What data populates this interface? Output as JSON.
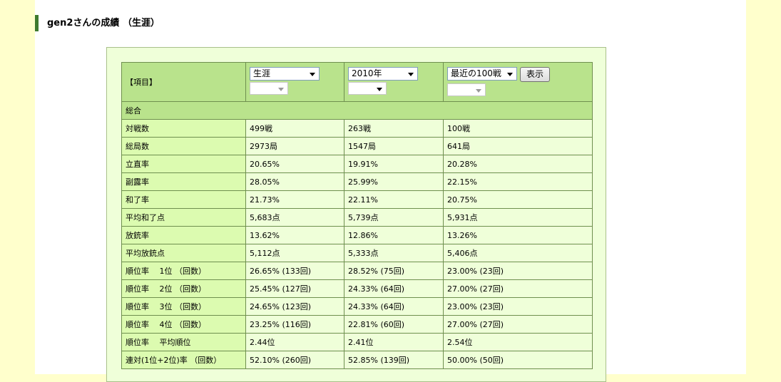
{
  "page": {
    "title": "gen2さんの成績 （生涯）"
  },
  "table": {
    "header_label": "【項目】",
    "selects": [
      {
        "value": "生涯",
        "sub_value": ""
      },
      {
        "value": "2010年",
        "sub_value": ""
      },
      {
        "value": "最近の100戦",
        "sub_value": ""
      }
    ],
    "show_button": "表示",
    "section_general": "総合",
    "rows": [
      {
        "label": "対戦数",
        "values": [
          "499戦",
          "263戦",
          "100戦"
        ]
      },
      {
        "label": "総局数",
        "values": [
          "2973局",
          "1547局",
          "641局"
        ]
      },
      {
        "label": "立直率",
        "values": [
          "20.65%",
          "19.91%",
          "20.28%"
        ]
      },
      {
        "label": "副露率",
        "values": [
          "28.05%",
          "25.99%",
          "22.15%"
        ]
      },
      {
        "label": "和了率",
        "values": [
          "21.73%",
          "22.11%",
          "20.75%"
        ]
      },
      {
        "label": "平均和了点",
        "values": [
          "5,683点",
          "5,739点",
          "5,931点"
        ]
      },
      {
        "label": "放銃率",
        "values": [
          "13.62%",
          "12.86%",
          "13.26%"
        ]
      },
      {
        "label": "平均放銃点",
        "values": [
          "5,112点",
          "5,333点",
          "5,406点"
        ]
      },
      {
        "label": "順位率　 1位 （回数）",
        "values": [
          "26.65% (133回)",
          "28.52% (75回)",
          "23.00% (23回)"
        ]
      },
      {
        "label": "順位率　 2位 （回数）",
        "values": [
          "25.45% (127回)",
          "24.33% (64回)",
          "27.00% (27回)"
        ]
      },
      {
        "label": "順位率　 3位 （回数）",
        "values": [
          "24.65% (123回)",
          "24.33% (64回)",
          "23.00% (23回)"
        ]
      },
      {
        "label": "順位率　 4位 （回数）",
        "values": [
          "23.25% (116回)",
          "22.81% (60回)",
          "27.00% (27回)"
        ]
      },
      {
        "label": "順位率　 平均順位",
        "values": [
          "2.44位",
          "2.41位",
          "2.54位"
        ]
      },
      {
        "label": "連対(1位+2位)率 （回数）",
        "values": [
          "52.10% (260回)",
          "52.85% (139回)",
          "50.00% (50回)"
        ]
      }
    ]
  }
}
